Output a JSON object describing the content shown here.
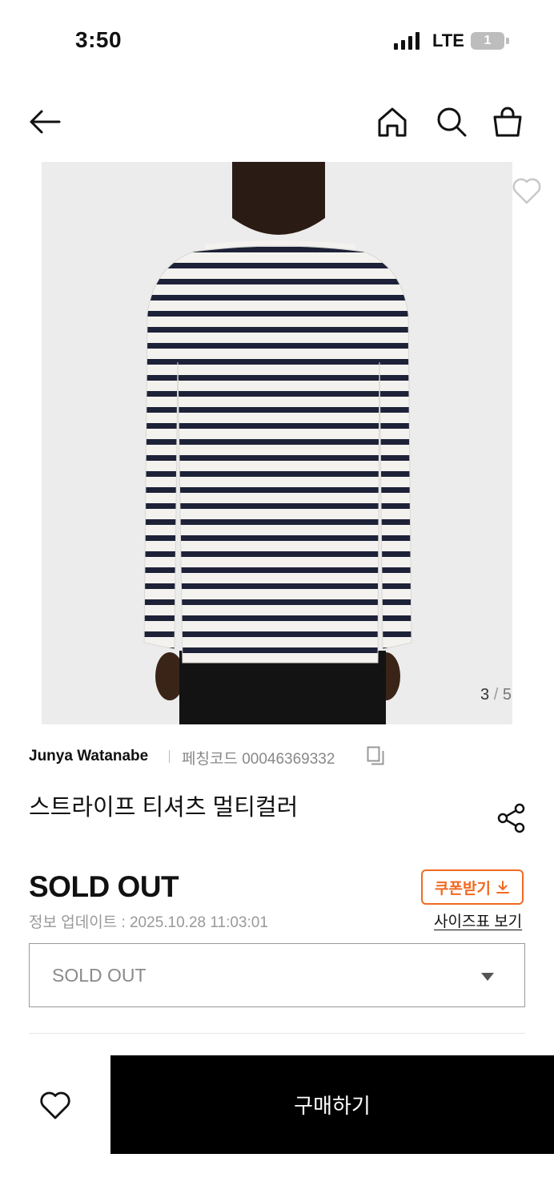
{
  "status_bar": {
    "time": "3:50",
    "network": "LTE",
    "battery": "1"
  },
  "header": {
    "back_icon": "arrow-left-icon",
    "home_icon": "home-icon",
    "search_icon": "search-icon",
    "bag_icon": "shopping-bag-icon"
  },
  "gallery": {
    "current": "3",
    "separator": "/",
    "total": "5"
  },
  "product": {
    "brand": "Junya Watanabe",
    "code_label": "페칭코드 00046369332",
    "title": "스트라이프 티셔츠 멀티컬러",
    "price_status": "SOLD OUT",
    "updated": "정보 업데이트 : 2025.10.28 11:03:01"
  },
  "actions": {
    "coupon": "쿠폰받기",
    "size_chart": "사이즈표 보기",
    "option_selected": "SOLD OUT",
    "buy": "구매하기"
  },
  "colors": {
    "accent": "#f26a21",
    "buy_bg": "#000000",
    "stripe": "#1d2238",
    "shirt": "#f3f2ee"
  }
}
